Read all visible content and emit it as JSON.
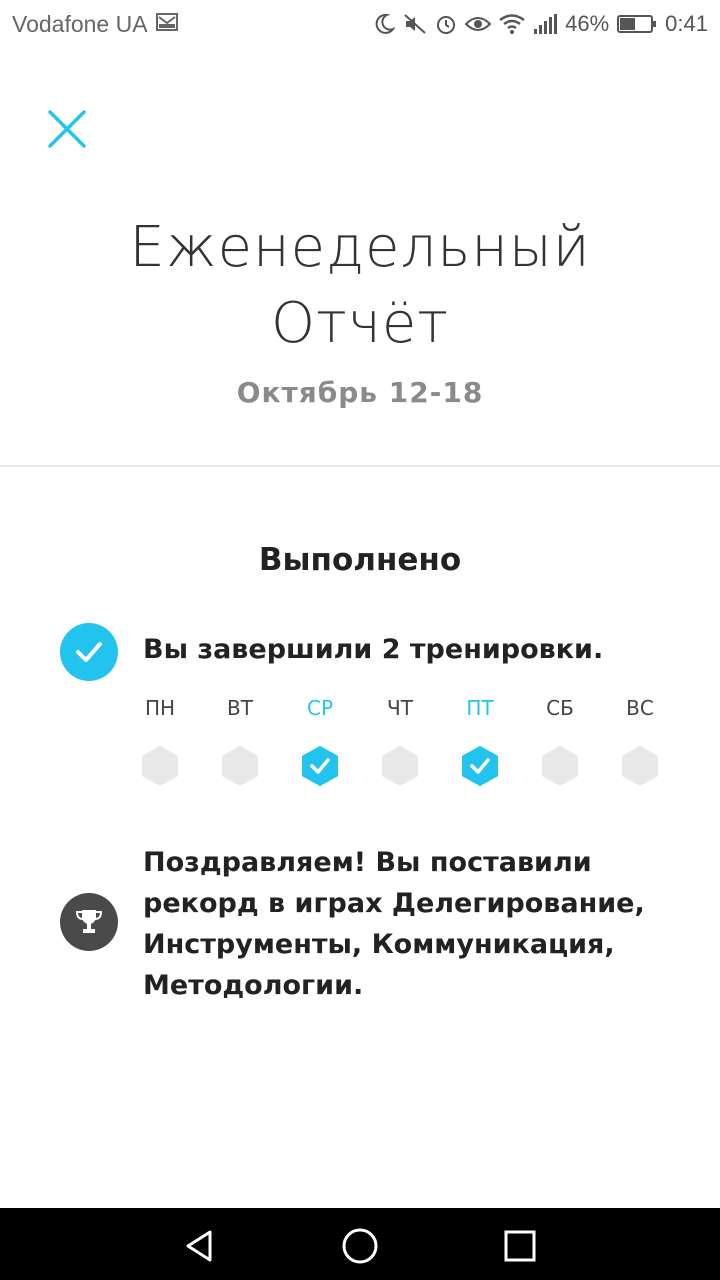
{
  "status_bar": {
    "carrier": "Vodafone UA",
    "battery": "46%",
    "time": "0:41"
  },
  "header": {
    "title_line1": "Еженедельный",
    "title_line2": "Отчёт",
    "date_range": "Октябрь 12-18"
  },
  "completed": {
    "heading": "Выполнено",
    "workouts_text": "Вы завершили 2 тренировки.",
    "days": [
      {
        "label": "ПН",
        "done": false
      },
      {
        "label": "ВТ",
        "done": false
      },
      {
        "label": "СР",
        "done": true
      },
      {
        "label": "ЧТ",
        "done": false
      },
      {
        "label": "ПТ",
        "done": true
      },
      {
        "label": "СБ",
        "done": false
      },
      {
        "label": "ВС",
        "done": false
      }
    ],
    "record_text": "Поздравляем! Вы поставили рекорд в играх Делегирование, Инструменты, Коммуникация, Методологии."
  },
  "colors": {
    "accent": "#23c3ef",
    "inactive_day": "#e8e8e8",
    "trophy_bg": "#4a4a4a"
  }
}
